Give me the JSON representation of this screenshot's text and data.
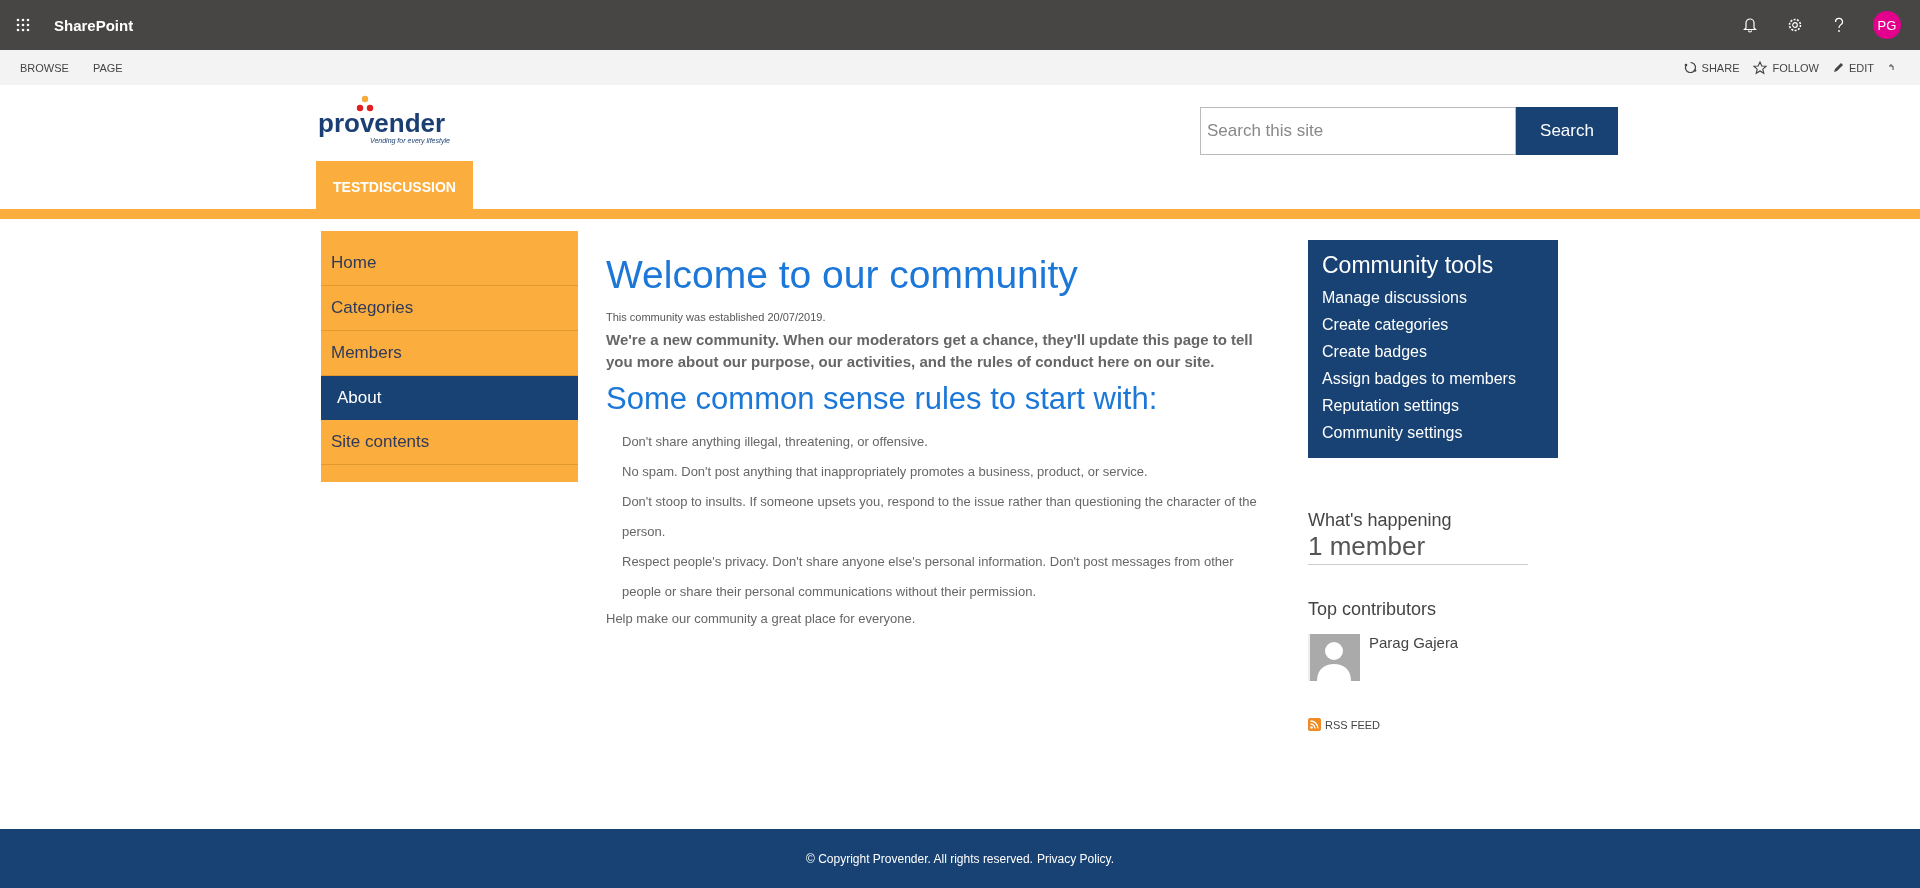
{
  "suite_bar": {
    "app_name": "SharePoint",
    "avatar_initials": "PG"
  },
  "ribbon": {
    "tabs": [
      {
        "label": "BROWSE",
        "selected": false
      },
      {
        "label": "PAGE",
        "selected": false
      }
    ],
    "actions": [
      {
        "kind": "share",
        "label": "SHARE"
      },
      {
        "kind": "follow",
        "label": "FOLLOW"
      },
      {
        "kind": "edit",
        "label": "EDIT"
      }
    ]
  },
  "header": {
    "logo": {
      "name": "provender",
      "tagline": "Vending for every lifestyle"
    },
    "search": {
      "placeholder": "Search this site",
      "button": "Search"
    },
    "site_tab": "TESTDISCUSSION"
  },
  "nav": [
    {
      "label": "Home",
      "selected": false
    },
    {
      "label": "Categories",
      "selected": false
    },
    {
      "label": "Members",
      "selected": false
    },
    {
      "label": "About",
      "selected": true
    },
    {
      "label": "Site contents",
      "selected": false
    }
  ],
  "content": {
    "title": "Welcome to our community",
    "established": "This community was established 20/07/2019.",
    "intro": "We're a new community. When our moderators get a chance, they'll update this page to tell you more about our purpose, our activities, and the rules of conduct here on our site.",
    "rules_heading": "Some common sense rules to start with:",
    "rules": [
      "Don't share anything illegal, threatening, or offensive.",
      "No spam. Don't post anything that inappropriately promotes a business, product, or service.",
      "Don't stoop to insults. If someone upsets you, respond to the issue rather than questioning the character of the person.",
      "Respect people's privacy. Don't share anyone else's personal information. Don't post messages from other people or share their personal communications without their permission."
    ],
    "closing": "Help make our community a great place for everyone."
  },
  "community_tools": {
    "title": "Community tools",
    "links": [
      "Manage discussions",
      "Create categories",
      "Create badges",
      "Assign badges to members",
      "Reputation settings",
      "Community settings"
    ]
  },
  "whats_happening": {
    "title": "What's happening",
    "members": "1 member"
  },
  "top_contributors": {
    "title": "Top contributors",
    "people": [
      {
        "name": "Parag Gajera"
      }
    ]
  },
  "rss": "RSS FEED",
  "footer": {
    "text": "© Copyright Provender. All rights reserved.",
    "link": "Privacy Policy."
  }
}
